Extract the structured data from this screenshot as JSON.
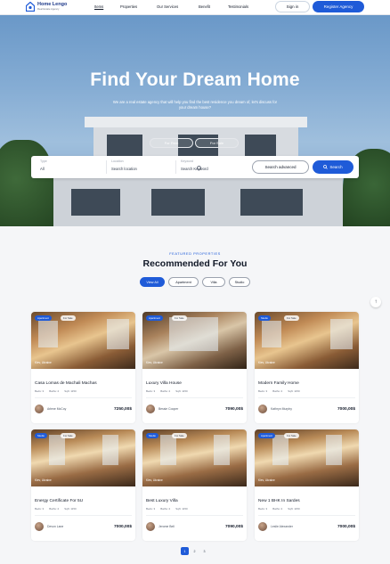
{
  "header": {
    "brand_name": "Home Lengo",
    "brand_tagline": "Real Estate Agency",
    "nav": [
      "Items",
      "Properties",
      "Our Services",
      "Benefit",
      "Testimonials"
    ],
    "signin_label": "Sign in",
    "register_label": "Register Agency"
  },
  "hero": {
    "title": "Find Your Dream Home",
    "subtitle": "We are a real estate agency that will help you find the best residence you dream of, let's discuss for your dream house?",
    "tabs": [
      "For Rent",
      "For Sale"
    ],
    "search": {
      "type_label": "Type",
      "type_value": "All",
      "location_label": "Location",
      "location_value": "Search location",
      "keyword_label": "Keyword",
      "keyword_value": "Search Keyword",
      "advanced_label": "Search advanced",
      "search_label": "Search"
    }
  },
  "recommended": {
    "eyebrow": "FEATURED PROPERTIES",
    "title": "Recommended For You",
    "filters": [
      "View All",
      "Apartment",
      "Villa",
      "Studio"
    ],
    "cards": [
      {
        "badge": "Apartment",
        "badge2": "For Sale",
        "location": "Kiev, Ukraine",
        "name": "Casa Lomas de Machali Machas",
        "beds": "Beds: 3",
        "baths": "Baths: 2",
        "sqft": "Sqft: 1150",
        "agent": "Arlene McCoy",
        "price": "7250,00$"
      },
      {
        "badge": "Apartment",
        "badge2": "For Sale",
        "location": "Kiev, Ukraine",
        "name": "Luxury Villa House",
        "beds": "Beds: 3",
        "baths": "Baths: 2",
        "sqft": "Sqft: 1150",
        "agent": "Bessie Cooper",
        "price": "7090,00$"
      },
      {
        "badge": "Studio",
        "badge2": "For Sale",
        "location": "Kiev, Ukraine",
        "name": "Modern Family Home",
        "beds": "Beds: 3",
        "baths": "Baths: 2",
        "sqft": "Sqft: 1150",
        "agent": "Kathryn Murphy",
        "price": "7000,00$"
      },
      {
        "badge": "Studio",
        "badge2": "For Sale",
        "location": "Kiev, Ukraine",
        "name": "Energy Certificate For 5U",
        "beds": "Beds: 3",
        "baths": "Baths: 2",
        "sqft": "Sqft: 1150",
        "agent": "Devon Lane",
        "price": "7000,00$"
      },
      {
        "badge": "Studio",
        "badge2": "For Sale",
        "location": "Kiev, Ukraine",
        "name": "Best Luxury Villa",
        "beds": "Beds: 3",
        "baths": "Baths: 2",
        "sqft": "Sqft: 1150",
        "agent": "Jerome Bell",
        "price": "7090,00$"
      },
      {
        "badge": "Apartment",
        "badge2": "For Sale",
        "location": "Kiev, Ukraine",
        "name": "New 1 BHK In Sardes",
        "beds": "Beds: 3",
        "baths": "Baths: 2",
        "sqft": "Sqft: 1150",
        "agent": "Leslie Alexander",
        "price": "7000,00$"
      }
    ]
  },
  "pager": [
    "1",
    "2",
    "3"
  ],
  "colors": {
    "accent": "#1f5bd8",
    "brand_dark": "#1e3a8a",
    "page_bg": "#f5f6f8"
  }
}
